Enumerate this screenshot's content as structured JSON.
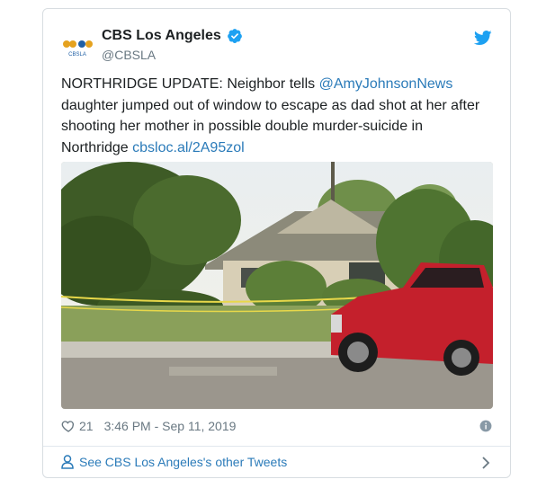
{
  "tweet": {
    "author_name": "CBS Los Angeles",
    "handle": "@CBSLA",
    "avatar_caption": "CBSLA",
    "text_prefix": "NORTHRIDGE UPDATE: Neighbor tells ",
    "mention": "@AmyJohnsonNews",
    "text_middle": " daughter jumped out of window to escape as dad shot at her after shooting her mother in possible double murder-suicide in Northridge ",
    "url": "cbsloc.al/2A95zol",
    "likes": "21",
    "timestamp": "3:46 PM - Sep 11, 2019",
    "footer_link": "See CBS Los Angeles's other Tweets"
  },
  "colors": {
    "link": "#2b7bb9",
    "verified": "#1da1f2",
    "twitter_brand": "#1da1f2",
    "meta_text": "#697882"
  },
  "icons": [
    "verified-badge-icon",
    "twitter-bird-icon",
    "heart-icon",
    "info-icon",
    "person-icon",
    "chevron-right-icon"
  ]
}
